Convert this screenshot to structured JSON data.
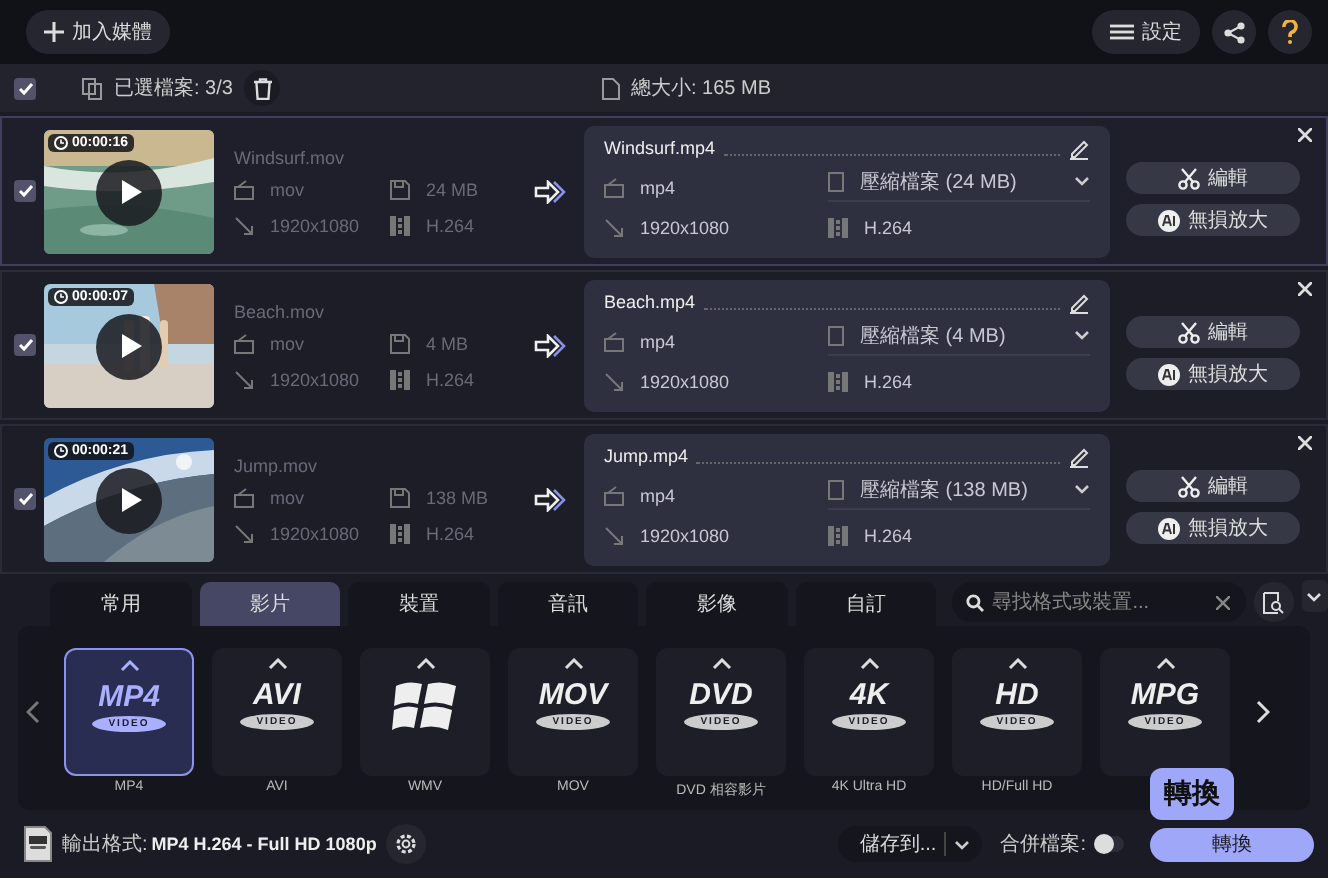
{
  "toolbar": {
    "add_media": "加入媒體",
    "settings": "設定"
  },
  "selection_bar": {
    "checked": true,
    "selected_files": "已選檔案: 3/3",
    "total_size": "總大小: 165 MB"
  },
  "files": [
    {
      "checked": true,
      "selected": true,
      "duration": "00:00:16",
      "source": {
        "name": "Windsurf.mov",
        "format": "mov",
        "size": "24 MB",
        "resolution": "1920x1080",
        "codec": "H.264"
      },
      "target": {
        "name": "Windsurf.mp4",
        "format": "mp4",
        "compression": "壓縮檔案 (24 MB)",
        "resolution": "1920x1080",
        "codec": "H.264"
      },
      "edit": "編輯",
      "upscale": "無損放大"
    },
    {
      "checked": true,
      "selected": false,
      "duration": "00:00:07",
      "source": {
        "name": "Beach.mov",
        "format": "mov",
        "size": "4 MB",
        "resolution": "1920x1080",
        "codec": "H.264"
      },
      "target": {
        "name": "Beach.mp4",
        "format": "mp4",
        "compression": "壓縮檔案 (4 MB)",
        "resolution": "1920x1080",
        "codec": "H.264"
      },
      "edit": "編輯",
      "upscale": "無損放大"
    },
    {
      "checked": true,
      "selected": false,
      "duration": "00:00:21",
      "source": {
        "name": "Jump.mov",
        "format": "mov",
        "size": "138 MB",
        "resolution": "1920x1080",
        "codec": "H.264"
      },
      "target": {
        "name": "Jump.mp4",
        "format": "mp4",
        "compression": "壓縮檔案 (138 MB)",
        "resolution": "1920x1080",
        "codec": "H.264"
      },
      "edit": "編輯",
      "upscale": "無損放大"
    }
  ],
  "tabs": [
    {
      "label": "常用",
      "selected": false
    },
    {
      "label": "影片",
      "selected": true
    },
    {
      "label": "裝置",
      "selected": false
    },
    {
      "label": "音訊",
      "selected": false
    },
    {
      "label": "影像",
      "selected": false
    },
    {
      "label": "自訂",
      "selected": false
    }
  ],
  "search": {
    "placeholder": "尋找格式或裝置..."
  },
  "formats": [
    {
      "kind": "logo",
      "logo": "MP4",
      "sub": "VIDEO",
      "label": "MP4",
      "selected": true
    },
    {
      "kind": "logo",
      "logo": "AVI",
      "sub": "VIDEO",
      "label": "AVI",
      "selected": false
    },
    {
      "kind": "windows",
      "label": "WMV",
      "selected": false
    },
    {
      "kind": "logo",
      "logo": "MOV",
      "sub": "VIDEO",
      "label": "MOV",
      "selected": false
    },
    {
      "kind": "logo",
      "logo": "DVD",
      "sub": "VIDEO",
      "label": "DVD 相容影片",
      "selected": false
    },
    {
      "kind": "logo",
      "logo": "4K",
      "sub": "VIDEO",
      "label": "4K Ultra HD",
      "selected": false
    },
    {
      "kind": "logo",
      "logo": "HD",
      "sub": "VIDEO",
      "label": "HD/Full HD",
      "selected": false
    },
    {
      "kind": "logo",
      "logo": "MPG",
      "sub": "VIDEO",
      "selected": false
    }
  ],
  "bottom": {
    "output_label": "輸出格式:",
    "output_value": "MP4 H.264 - Full HD 1080p",
    "save_to": "儲存到...",
    "merge_label": "合併檔案:",
    "merge_on": false,
    "convert": "轉換",
    "tooltip": "轉換"
  }
}
